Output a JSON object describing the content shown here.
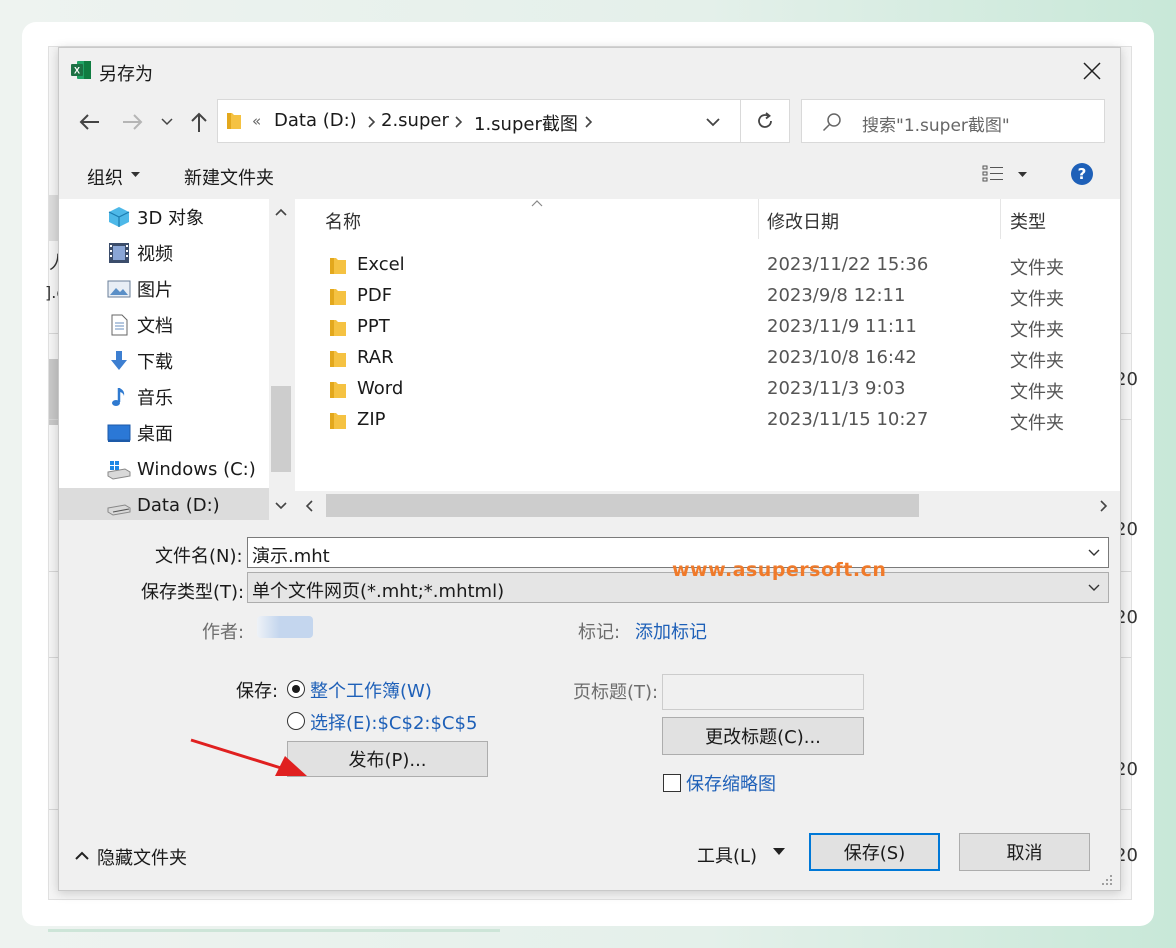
{
  "dialog": {
    "title": "另存为",
    "colors": {
      "accent": "#0078d7",
      "link": "#1e60b8",
      "watermark": "#f07a2a",
      "excel_green": "#1d7044"
    }
  },
  "nav": {
    "back_icon": "arrow-left-icon",
    "forward_icon": "arrow-right-icon",
    "recent_icon": "chevron-down-icon",
    "up_icon": "arrow-up-icon"
  },
  "address": {
    "overflow": "«",
    "crumbs": [
      "Data (D:)",
      "2.super",
      "1.super截图"
    ],
    "refresh_icon": "refresh-icon"
  },
  "search": {
    "placeholder": "搜索\"1.super截图\""
  },
  "toolbar": {
    "organize": "组织",
    "new_folder": "新建文件夹",
    "view_icon": "details-view-icon",
    "help": "?"
  },
  "tree": {
    "items": [
      {
        "label": "3D 对象",
        "icon": "3d-objects-icon"
      },
      {
        "label": "视频",
        "icon": "video-icon"
      },
      {
        "label": "图片",
        "icon": "pictures-icon"
      },
      {
        "label": "文档",
        "icon": "documents-icon"
      },
      {
        "label": "下载",
        "icon": "download-icon"
      },
      {
        "label": "音乐",
        "icon": "music-icon"
      },
      {
        "label": "桌面",
        "icon": "desktop-icon"
      },
      {
        "label": "Windows (C:)",
        "icon": "windows-drive-icon"
      },
      {
        "label": "Data (D:)",
        "icon": "drive-icon",
        "selected": true
      }
    ]
  },
  "list": {
    "columns": {
      "name": "名称",
      "date": "修改日期",
      "type": "类型"
    },
    "rows": [
      {
        "name": "Excel",
        "date": "2023/11/22 15:36",
        "type": "文件夹"
      },
      {
        "name": "PDF",
        "date": "2023/9/8 12:11",
        "type": "文件夹"
      },
      {
        "name": "PPT",
        "date": "2023/11/9 11:11",
        "type": "文件夹"
      },
      {
        "name": "RAR",
        "date": "2023/10/8 16:42",
        "type": "文件夹"
      },
      {
        "name": "Word",
        "date": "2023/11/3 9:03",
        "type": "文件夹"
      },
      {
        "name": "ZIP",
        "date": "2023/11/15 10:27",
        "type": "文件夹"
      }
    ]
  },
  "form": {
    "filename_label": "文件名(N):",
    "filename_value": "演示.mht",
    "filetype_label": "保存类型(T):",
    "filetype_value": "单个文件网页(*.mht;*.mhtml)",
    "author_label": "作者:",
    "tags_label": "标记:",
    "tags_value": "添加标记",
    "save_label": "保存:",
    "radio_workbook": "整个工作簿(W)",
    "radio_selection": "选择(E):$C$2:$C$5",
    "publish": "发布(P)...",
    "page_title_label": "页标题(T):",
    "page_title_value": "",
    "change_title": "更改标题(C)...",
    "thumbnail": "保存缩略图"
  },
  "footer": {
    "hide_folders": "隐藏文件夹",
    "tools": "工具(L)",
    "save": "保存(S)",
    "cancel": "取消"
  },
  "watermark": "www.asupersoft.cn",
  "background_fragments": [
    "人",
    "].c",
    "20"
  ]
}
